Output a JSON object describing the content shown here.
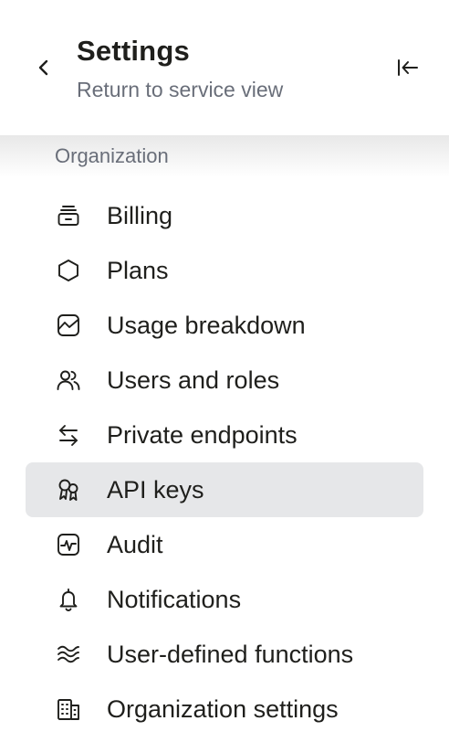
{
  "header": {
    "title": "Settings",
    "subtitle": "Return to service view"
  },
  "icons": {
    "back": "chevron-left-icon",
    "collapse": "collapse-sidebar-icon"
  },
  "section": {
    "label": "Organization"
  },
  "colors": {
    "active_bg": "#e6e7e9",
    "muted_text": "#696e79",
    "text": "#1f1f1c"
  },
  "menu": {
    "items": [
      {
        "label": "Billing",
        "icon": "billing-icon",
        "active": false
      },
      {
        "label": "Plans",
        "icon": "hexagon-icon",
        "active": false
      },
      {
        "label": "Usage breakdown",
        "icon": "usage-chart-icon",
        "active": false
      },
      {
        "label": "Users and roles",
        "icon": "users-icon",
        "active": false
      },
      {
        "label": "Private endpoints",
        "icon": "arrows-swap-icon",
        "active": false
      },
      {
        "label": "API keys",
        "icon": "keys-icon",
        "active": true
      },
      {
        "label": "Audit",
        "icon": "activity-icon",
        "active": false
      },
      {
        "label": "Notifications",
        "icon": "bell-icon",
        "active": false
      },
      {
        "label": "User-defined functions",
        "icon": "wave-lines-icon",
        "active": false
      },
      {
        "label": "Organization settings",
        "icon": "building-icon",
        "active": false
      }
    ]
  }
}
